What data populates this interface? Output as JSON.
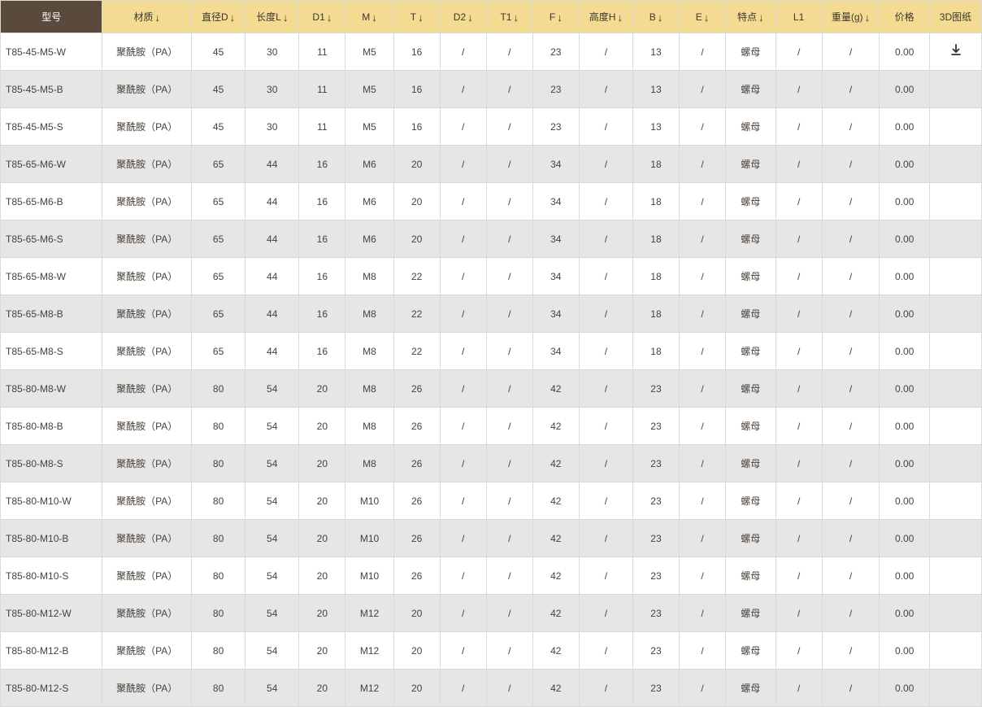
{
  "columns": [
    {
      "key": "model",
      "label": "型号",
      "sortable": false
    },
    {
      "key": "material",
      "label": "材质",
      "sortable": true
    },
    {
      "key": "diameterD",
      "label": "直径D",
      "sortable": true
    },
    {
      "key": "lengthL",
      "label": "长度L",
      "sortable": true
    },
    {
      "key": "D1",
      "label": "D1",
      "sortable": true
    },
    {
      "key": "M",
      "label": "M",
      "sortable": true
    },
    {
      "key": "T",
      "label": "T",
      "sortable": true
    },
    {
      "key": "D2",
      "label": "D2",
      "sortable": true
    },
    {
      "key": "T1",
      "label": "T1",
      "sortable": true
    },
    {
      "key": "F",
      "label": "F",
      "sortable": true
    },
    {
      "key": "heightH",
      "label": "高度H",
      "sortable": true
    },
    {
      "key": "B",
      "label": "B",
      "sortable": true
    },
    {
      "key": "E",
      "label": "E",
      "sortable": true
    },
    {
      "key": "feature",
      "label": "特点",
      "sortable": true
    },
    {
      "key": "L1",
      "label": "L1",
      "sortable": false
    },
    {
      "key": "weight",
      "label": "重量(g)",
      "sortable": true
    },
    {
      "key": "price",
      "label": "价格",
      "sortable": false
    },
    {
      "key": "drawing3d",
      "label": "3D图纸",
      "sortable": false
    }
  ],
  "sort_arrow": "↓",
  "rows": [
    {
      "model": "T85-45-M5-W",
      "material": "聚酰胺（PA）",
      "diameterD": "45",
      "lengthL": "30",
      "D1": "11",
      "M": "M5",
      "T": "16",
      "D2": "/",
      "T1": "/",
      "F": "23",
      "heightH": "/",
      "B": "13",
      "E": "/",
      "feature": "螺母",
      "L1": "/",
      "weight": "/",
      "price": "0.00",
      "download": true
    },
    {
      "model": "T85-45-M5-B",
      "material": "聚酰胺（PA）",
      "diameterD": "45",
      "lengthL": "30",
      "D1": "11",
      "M": "M5",
      "T": "16",
      "D2": "/",
      "T1": "/",
      "F": "23",
      "heightH": "/",
      "B": "13",
      "E": "/",
      "feature": "螺母",
      "L1": "/",
      "weight": "/",
      "price": "0.00",
      "download": false
    },
    {
      "model": "T85-45-M5-S",
      "material": "聚酰胺（PA）",
      "diameterD": "45",
      "lengthL": "30",
      "D1": "11",
      "M": "M5",
      "T": "16",
      "D2": "/",
      "T1": "/",
      "F": "23",
      "heightH": "/",
      "B": "13",
      "E": "/",
      "feature": "螺母",
      "L1": "/",
      "weight": "/",
      "price": "0.00",
      "download": false
    },
    {
      "model": "T85-65-M6-W",
      "material": "聚酰胺（PA）",
      "diameterD": "65",
      "lengthL": "44",
      "D1": "16",
      "M": "M6",
      "T": "20",
      "D2": "/",
      "T1": "/",
      "F": "34",
      "heightH": "/",
      "B": "18",
      "E": "/",
      "feature": "螺母",
      "L1": "/",
      "weight": "/",
      "price": "0.00",
      "download": false
    },
    {
      "model": "T85-65-M6-B",
      "material": "聚酰胺（PA）",
      "diameterD": "65",
      "lengthL": "44",
      "D1": "16",
      "M": "M6",
      "T": "20",
      "D2": "/",
      "T1": "/",
      "F": "34",
      "heightH": "/",
      "B": "18",
      "E": "/",
      "feature": "螺母",
      "L1": "/",
      "weight": "/",
      "price": "0.00",
      "download": false
    },
    {
      "model": "T85-65-M6-S",
      "material": "聚酰胺（PA）",
      "diameterD": "65",
      "lengthL": "44",
      "D1": "16",
      "M": "M6",
      "T": "20",
      "D2": "/",
      "T1": "/",
      "F": "34",
      "heightH": "/",
      "B": "18",
      "E": "/",
      "feature": "螺母",
      "L1": "/",
      "weight": "/",
      "price": "0.00",
      "download": false
    },
    {
      "model": "T85-65-M8-W",
      "material": "聚酰胺（PA）",
      "diameterD": "65",
      "lengthL": "44",
      "D1": "16",
      "M": "M8",
      "T": "22",
      "D2": "/",
      "T1": "/",
      "F": "34",
      "heightH": "/",
      "B": "18",
      "E": "/",
      "feature": "螺母",
      "L1": "/",
      "weight": "/",
      "price": "0.00",
      "download": false
    },
    {
      "model": "T85-65-M8-B",
      "material": "聚酰胺（PA）",
      "diameterD": "65",
      "lengthL": "44",
      "D1": "16",
      "M": "M8",
      "T": "22",
      "D2": "/",
      "T1": "/",
      "F": "34",
      "heightH": "/",
      "B": "18",
      "E": "/",
      "feature": "螺母",
      "L1": "/",
      "weight": "/",
      "price": "0.00",
      "download": false
    },
    {
      "model": "T85-65-M8-S",
      "material": "聚酰胺（PA）",
      "diameterD": "65",
      "lengthL": "44",
      "D1": "16",
      "M": "M8",
      "T": "22",
      "D2": "/",
      "T1": "/",
      "F": "34",
      "heightH": "/",
      "B": "18",
      "E": "/",
      "feature": "螺母",
      "L1": "/",
      "weight": "/",
      "price": "0.00",
      "download": false
    },
    {
      "model": "T85-80-M8-W",
      "material": "聚酰胺（PA）",
      "diameterD": "80",
      "lengthL": "54",
      "D1": "20",
      "M": "M8",
      "T": "26",
      "D2": "/",
      "T1": "/",
      "F": "42",
      "heightH": "/",
      "B": "23",
      "E": "/",
      "feature": "螺母",
      "L1": "/",
      "weight": "/",
      "price": "0.00",
      "download": false
    },
    {
      "model": "T85-80-M8-B",
      "material": "聚酰胺（PA）",
      "diameterD": "80",
      "lengthL": "54",
      "D1": "20",
      "M": "M8",
      "T": "26",
      "D2": "/",
      "T1": "/",
      "F": "42",
      "heightH": "/",
      "B": "23",
      "E": "/",
      "feature": "螺母",
      "L1": "/",
      "weight": "/",
      "price": "0.00",
      "download": false
    },
    {
      "model": "T85-80-M8-S",
      "material": "聚酰胺（PA）",
      "diameterD": "80",
      "lengthL": "54",
      "D1": "20",
      "M": "M8",
      "T": "26",
      "D2": "/",
      "T1": "/",
      "F": "42",
      "heightH": "/",
      "B": "23",
      "E": "/",
      "feature": "螺母",
      "L1": "/",
      "weight": "/",
      "price": "0.00",
      "download": false
    },
    {
      "model": "T85-80-M10-W",
      "material": "聚酰胺（PA）",
      "diameterD": "80",
      "lengthL": "54",
      "D1": "20",
      "M": "M10",
      "T": "26",
      "D2": "/",
      "T1": "/",
      "F": "42",
      "heightH": "/",
      "B": "23",
      "E": "/",
      "feature": "螺母",
      "L1": "/",
      "weight": "/",
      "price": "0.00",
      "download": false
    },
    {
      "model": "T85-80-M10-B",
      "material": "聚酰胺（PA）",
      "diameterD": "80",
      "lengthL": "54",
      "D1": "20",
      "M": "M10",
      "T": "26",
      "D2": "/",
      "T1": "/",
      "F": "42",
      "heightH": "/",
      "B": "23",
      "E": "/",
      "feature": "螺母",
      "L1": "/",
      "weight": "/",
      "price": "0.00",
      "download": false
    },
    {
      "model": "T85-80-M10-S",
      "material": "聚酰胺（PA）",
      "diameterD": "80",
      "lengthL": "54",
      "D1": "20",
      "M": "M10",
      "T": "26",
      "D2": "/",
      "T1": "/",
      "F": "42",
      "heightH": "/",
      "B": "23",
      "E": "/",
      "feature": "螺母",
      "L1": "/",
      "weight": "/",
      "price": "0.00",
      "download": false
    },
    {
      "model": "T85-80-M12-W",
      "material": "聚酰胺（PA）",
      "diameterD": "80",
      "lengthL": "54",
      "D1": "20",
      "M": "M12",
      "T": "20",
      "D2": "/",
      "T1": "/",
      "F": "42",
      "heightH": "/",
      "B": "23",
      "E": "/",
      "feature": "螺母",
      "L1": "/",
      "weight": "/",
      "price": "0.00",
      "download": false
    },
    {
      "model": "T85-80-M12-B",
      "material": "聚酰胺（PA）",
      "diameterD": "80",
      "lengthL": "54",
      "D1": "20",
      "M": "M12",
      "T": "20",
      "D2": "/",
      "T1": "/",
      "F": "42",
      "heightH": "/",
      "B": "23",
      "E": "/",
      "feature": "螺母",
      "L1": "/",
      "weight": "/",
      "price": "0.00",
      "download": false
    },
    {
      "model": "T85-80-M12-S",
      "material": "聚酰胺（PA）",
      "diameterD": "80",
      "lengthL": "54",
      "D1": "20",
      "M": "M12",
      "T": "20",
      "D2": "/",
      "T1": "/",
      "F": "42",
      "heightH": "/",
      "B": "23",
      "E": "/",
      "feature": "螺母",
      "L1": "/",
      "weight": "/",
      "price": "0.00",
      "download": false
    }
  ]
}
